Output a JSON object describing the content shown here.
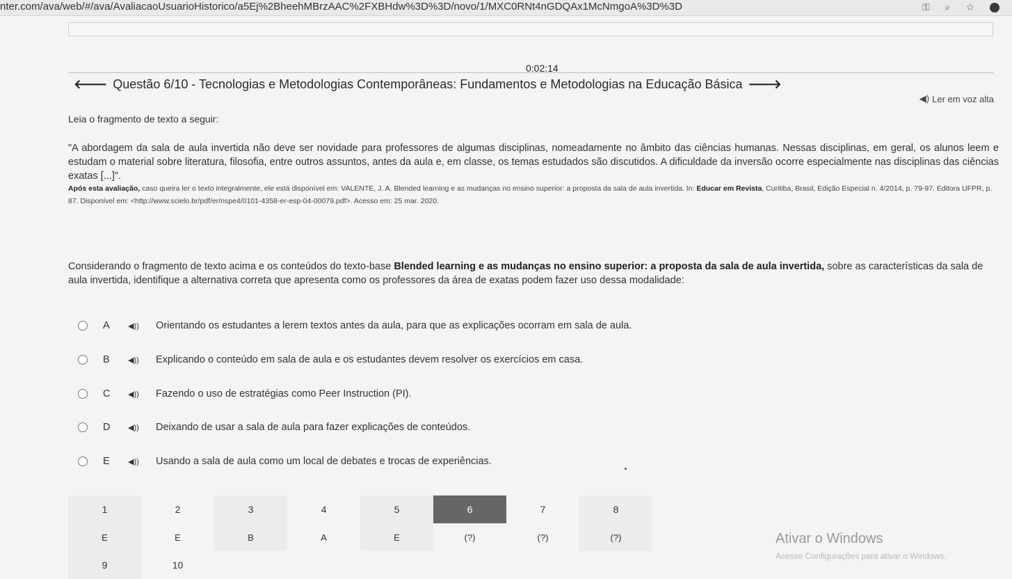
{
  "browser": {
    "url": "nter.com/ava/web/#/ava/AvaliacaoUsuarioHistorico/a5Ej%2BheehMBrzAAC%2FXBHdw%3D%3D/novo/1/MXC0RNt4nGDQAx1McNmgoA%3D%3D"
  },
  "timer": "0:02:14",
  "question_title": "Questão 6/10 - Tecnologias e Metodologias Contemporâneas: Fundamentos e Metodologias na Educação Básica",
  "read_aloud_label": "Ler em voz alta",
  "intro": "Leia o fragmento de texto a seguir:",
  "quote": "\"A abordagem da sala de aula invertida não deve ser novidade para professores de algumas disciplinas, nomeadamente no âmbito das ciências humanas. Nessas disciplinas, em geral, os alunos leem e estudam o material sobre literatura, filosofia, entre outros assuntos, antes da aula e, em classe, os temas estudados são discutidos. A dificuldade da inversão ocorre especialmente nas disciplinas das ciências exatas [...]\".",
  "reference": {
    "bold_part": "Após esta avaliação,",
    "text_part": " caso queira ler o texto integralmente, ele está disponível em: VALENTE, J. A. Blended learning e as mudanças no ensino superior: a proposta da sala de aula invertida. In: ",
    "bold_journal": "Educar em Revista",
    "text_tail": ", Curitiba, Brasil, Edição Especial n. 4/2014, p. 79-97. Editora UFPR, p. 87. Disponível em: <http://www.scielo.br/pdf/er/nspe4/0101-4358-er-esp-04-00079.pdf>. Acesso em: 25 mar. 2020."
  },
  "question": {
    "pre": "Considerando o fragmento de texto acima e os conteúdos do texto-base ",
    "bold": "Blended learning e as mudanças no ensino superior: a proposta da sala de aula invertida,",
    "post": " sobre as características da sala de aula invertida, identifique a alternativa correta que apresenta como os professores da área de exatas podem fazer uso dessa modalidade:"
  },
  "options": [
    {
      "letter": "A",
      "text": "Orientando os estudantes a lerem textos antes da aula, para que as explicações ocorram em sala de aula."
    },
    {
      "letter": "B",
      "text": "Explicando o conteúdo em sala de aula e os estudantes devem resolver os exercícios em casa."
    },
    {
      "letter": "C",
      "text": "Fazendo o uso de estratégias como Peer Instruction (PI)."
    },
    {
      "letter": "D",
      "text": "Deixando de usar a sala de aula para fazer explicações de conteúdos."
    },
    {
      "letter": "E",
      "text": "Usando a sala de aula como um local de debates e trocas de experiências."
    }
  ],
  "navigation": {
    "numbers": [
      "1",
      "2",
      "3",
      "4",
      "5",
      "6",
      "7",
      "8"
    ],
    "answers": [
      "E",
      "E",
      "B",
      "A",
      "E",
      "(?)",
      "(?)",
      "(?)"
    ],
    "numbers_row2": [
      "9",
      "10"
    ],
    "active_index": 5
  },
  "windows_notice": {
    "title": "Ativar o Windows",
    "subtitle": "Acesse Configurações para ativar o Windows."
  },
  "colors": {
    "active_cell": "#666666",
    "cell_bg": "#ececec"
  }
}
